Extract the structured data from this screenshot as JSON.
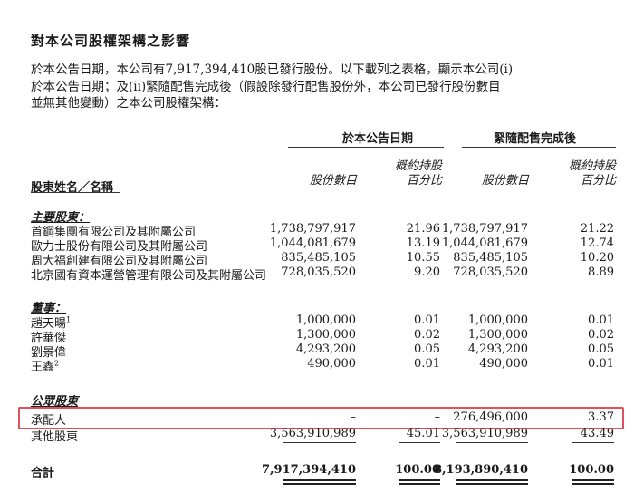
{
  "title": "對本公司股權架構之影響",
  "intro_lines": [
    "於本公告日期，本公司有7,917,394,410股已發行股份。以下載列之表格，顯示本公司(i)",
    "於本公告日期；及(ii)緊隨配售完成後（假設除發行配售股份外，本公司已發行股份數目",
    "並無其他變動）之本公司股權架構："
  ],
  "table": {
    "group_headers": [
      "於本公告日期",
      "緊隨配售完成後"
    ],
    "shareholder_header": "股東姓名／名稱",
    "col_shares": "股份數目",
    "col_pct_line1": "概約持股",
    "col_pct_line2": "百分比",
    "sections": [
      {
        "title": "主要股東：",
        "rows": [
          {
            "name": "首鋼集團有限公司及其附屬公司",
            "sup": "",
            "s1": "1,738,797,917",
            "p1": "21.96",
            "s2": "1,738,797,917",
            "p2": "21.22"
          },
          {
            "name": "歐力士股份有限公司及其附屬公司",
            "sup": "",
            "s1": "1,044,081,679",
            "p1": "13.19",
            "s2": "1,044,081,679",
            "p2": "12.74"
          },
          {
            "name": "周大福創建有限公司及其附屬公司",
            "sup": "",
            "s1": "835,485,105",
            "p1": "10.55",
            "s2": "835,485,105",
            "p2": "10.20"
          },
          {
            "name": "北京國有資本運營管理有限公司及其附屬公司",
            "sup": "",
            "s1": "728,035,520",
            "p1": "9.20",
            "s2": "728,035,520",
            "p2": "8.89"
          }
        ]
      },
      {
        "title": "董事：",
        "rows": [
          {
            "name": "趙天暘",
            "sup": "1",
            "s1": "1,000,000",
            "p1": "0.01",
            "s2": "1,000,000",
            "p2": "0.01"
          },
          {
            "name": "許華傑",
            "sup": "",
            "s1": "1,300,000",
            "p1": "0.02",
            "s2": "1,300,000",
            "p2": "0.02"
          },
          {
            "name": "劉景偉",
            "sup": "",
            "s1": "4,293,200",
            "p1": "0.05",
            "s2": "4,293,200",
            "p2": "0.05"
          },
          {
            "name": "王鑫",
            "sup": "2",
            "s1": "490,000",
            "p1": "0.01",
            "s2": "490,000",
            "p2": "0.01"
          }
        ]
      },
      {
        "title": "公眾股東",
        "rows": [
          {
            "name": "承配人",
            "sup": "",
            "s1": "–",
            "p1": "–",
            "s2": "276,496,000",
            "p2": "3.37",
            "highlighted": true
          },
          {
            "name": "其他股東",
            "sup": "",
            "s1": "3,563,910,989",
            "p1": "45.01",
            "s2": "3,563,910,989",
            "p2": "43.49"
          }
        ]
      }
    ],
    "total": {
      "name": "合計",
      "s1": "7,917,394,410",
      "p1": "100.00",
      "s2": "8,193,890,410",
      "p2": "100.00"
    }
  },
  "highlight_color": "#e0505c"
}
